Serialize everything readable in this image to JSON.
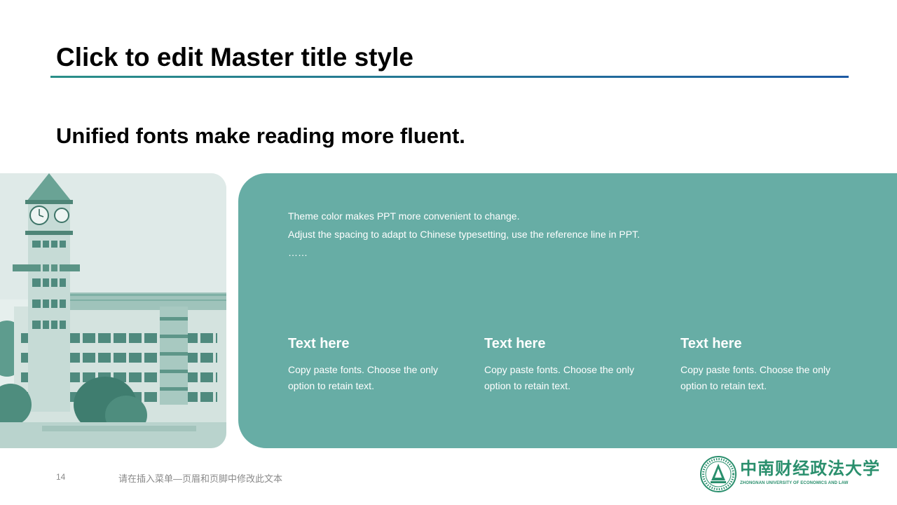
{
  "slide": {
    "title": "Click to edit Master title style",
    "subtitle": "Unified fonts make reading more fluent."
  },
  "panel": {
    "intro_lines": [
      "Theme color makes PPT more convenient  to change.",
      "Adjust  the  spacing  to adapt  to Chinese  typesetting,  use  the  reference line  in  PPT.",
      "……"
    ],
    "columns": [
      {
        "title": "Text here",
        "body": "Copy paste fonts. Choose the only  option to retain  text."
      },
      {
        "title": "Text here",
        "body": "Copy paste fonts. Choose the only  option to retain  text."
      },
      {
        "title": "Text here",
        "body": "Copy paste fonts. Choose the only  option to retain  text."
      }
    ]
  },
  "footer": {
    "page_number": "14",
    "text": "请在插入菜单—页眉和页脚中修改此文本"
  },
  "logo": {
    "name_cn": "中南财经政法大学",
    "name_en": "ZHONGNAN UNIVERSITY OF ECONOMICS AND LAW"
  },
  "colors": {
    "accent_teal": "#67ada5",
    "rule_start": "#2a8f88",
    "rule_end": "#1d5aa3",
    "logo_green": "#2a8f6d"
  },
  "icons": {
    "photo": "campus-clock-tower-image",
    "seal": "university-seal-icon"
  }
}
